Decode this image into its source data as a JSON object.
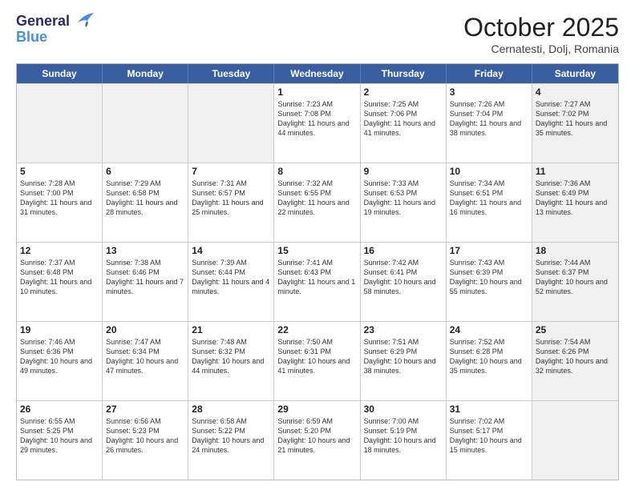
{
  "header": {
    "logo_line1": "General",
    "logo_line2": "Blue",
    "month": "October 2025",
    "location": "Cernatesti, Dolj, Romania"
  },
  "days_of_week": [
    "Sunday",
    "Monday",
    "Tuesday",
    "Wednesday",
    "Thursday",
    "Friday",
    "Saturday"
  ],
  "weeks": [
    [
      {
        "day": "",
        "text": "",
        "shaded": true
      },
      {
        "day": "",
        "text": "",
        "shaded": true
      },
      {
        "day": "",
        "text": "",
        "shaded": true
      },
      {
        "day": "1",
        "text": "Sunrise: 7:23 AM\nSunset: 7:08 PM\nDaylight: 11 hours and 44 minutes."
      },
      {
        "day": "2",
        "text": "Sunrise: 7:25 AM\nSunset: 7:06 PM\nDaylight: 11 hours and 41 minutes."
      },
      {
        "day": "3",
        "text": "Sunrise: 7:26 AM\nSunset: 7:04 PM\nDaylight: 11 hours and 38 minutes."
      },
      {
        "day": "4",
        "text": "Sunrise: 7:27 AM\nSunset: 7:02 PM\nDaylight: 11 hours and 35 minutes.",
        "shaded": true
      }
    ],
    [
      {
        "day": "5",
        "text": "Sunrise: 7:28 AM\nSunset: 7:00 PM\nDaylight: 11 hours and 31 minutes."
      },
      {
        "day": "6",
        "text": "Sunrise: 7:29 AM\nSunset: 6:58 PM\nDaylight: 11 hours and 28 minutes."
      },
      {
        "day": "7",
        "text": "Sunrise: 7:31 AM\nSunset: 6:57 PM\nDaylight: 11 hours and 25 minutes."
      },
      {
        "day": "8",
        "text": "Sunrise: 7:32 AM\nSunset: 6:55 PM\nDaylight: 11 hours and 22 minutes."
      },
      {
        "day": "9",
        "text": "Sunrise: 7:33 AM\nSunset: 6:53 PM\nDaylight: 11 hours and 19 minutes."
      },
      {
        "day": "10",
        "text": "Sunrise: 7:34 AM\nSunset: 6:51 PM\nDaylight: 11 hours and 16 minutes."
      },
      {
        "day": "11",
        "text": "Sunrise: 7:36 AM\nSunset: 6:49 PM\nDaylight: 11 hours and 13 minutes.",
        "shaded": true
      }
    ],
    [
      {
        "day": "12",
        "text": "Sunrise: 7:37 AM\nSunset: 6:48 PM\nDaylight: 11 hours and 10 minutes."
      },
      {
        "day": "13",
        "text": "Sunrise: 7:38 AM\nSunset: 6:46 PM\nDaylight: 11 hours and 7 minutes."
      },
      {
        "day": "14",
        "text": "Sunrise: 7:39 AM\nSunset: 6:44 PM\nDaylight: 11 hours and 4 minutes."
      },
      {
        "day": "15",
        "text": "Sunrise: 7:41 AM\nSunset: 6:43 PM\nDaylight: 11 hours and 1 minute."
      },
      {
        "day": "16",
        "text": "Sunrise: 7:42 AM\nSunset: 6:41 PM\nDaylight: 10 hours and 58 minutes."
      },
      {
        "day": "17",
        "text": "Sunrise: 7:43 AM\nSunset: 6:39 PM\nDaylight: 10 hours and 55 minutes."
      },
      {
        "day": "18",
        "text": "Sunrise: 7:44 AM\nSunset: 6:37 PM\nDaylight: 10 hours and 52 minutes.",
        "shaded": true
      }
    ],
    [
      {
        "day": "19",
        "text": "Sunrise: 7:46 AM\nSunset: 6:36 PM\nDaylight: 10 hours and 49 minutes."
      },
      {
        "day": "20",
        "text": "Sunrise: 7:47 AM\nSunset: 6:34 PM\nDaylight: 10 hours and 47 minutes."
      },
      {
        "day": "21",
        "text": "Sunrise: 7:48 AM\nSunset: 6:32 PM\nDaylight: 10 hours and 44 minutes."
      },
      {
        "day": "22",
        "text": "Sunrise: 7:50 AM\nSunset: 6:31 PM\nDaylight: 10 hours and 41 minutes."
      },
      {
        "day": "23",
        "text": "Sunrise: 7:51 AM\nSunset: 6:29 PM\nDaylight: 10 hours and 38 minutes."
      },
      {
        "day": "24",
        "text": "Sunrise: 7:52 AM\nSunset: 6:28 PM\nDaylight: 10 hours and 35 minutes."
      },
      {
        "day": "25",
        "text": "Sunrise: 7:54 AM\nSunset: 6:26 PM\nDaylight: 10 hours and 32 minutes.",
        "shaded": true
      }
    ],
    [
      {
        "day": "26",
        "text": "Sunrise: 6:55 AM\nSunset: 5:25 PM\nDaylight: 10 hours and 29 minutes."
      },
      {
        "day": "27",
        "text": "Sunrise: 6:56 AM\nSunset: 5:23 PM\nDaylight: 10 hours and 26 minutes."
      },
      {
        "day": "28",
        "text": "Sunrise: 6:58 AM\nSunset: 5:22 PM\nDaylight: 10 hours and 24 minutes."
      },
      {
        "day": "29",
        "text": "Sunrise: 6:59 AM\nSunset: 5:20 PM\nDaylight: 10 hours and 21 minutes."
      },
      {
        "day": "30",
        "text": "Sunrise: 7:00 AM\nSunset: 5:19 PM\nDaylight: 10 hours and 18 minutes."
      },
      {
        "day": "31",
        "text": "Sunrise: 7:02 AM\nSunset: 5:17 PM\nDaylight: 10 hours and 15 minutes."
      },
      {
        "day": "",
        "text": "",
        "shaded": true
      }
    ]
  ]
}
